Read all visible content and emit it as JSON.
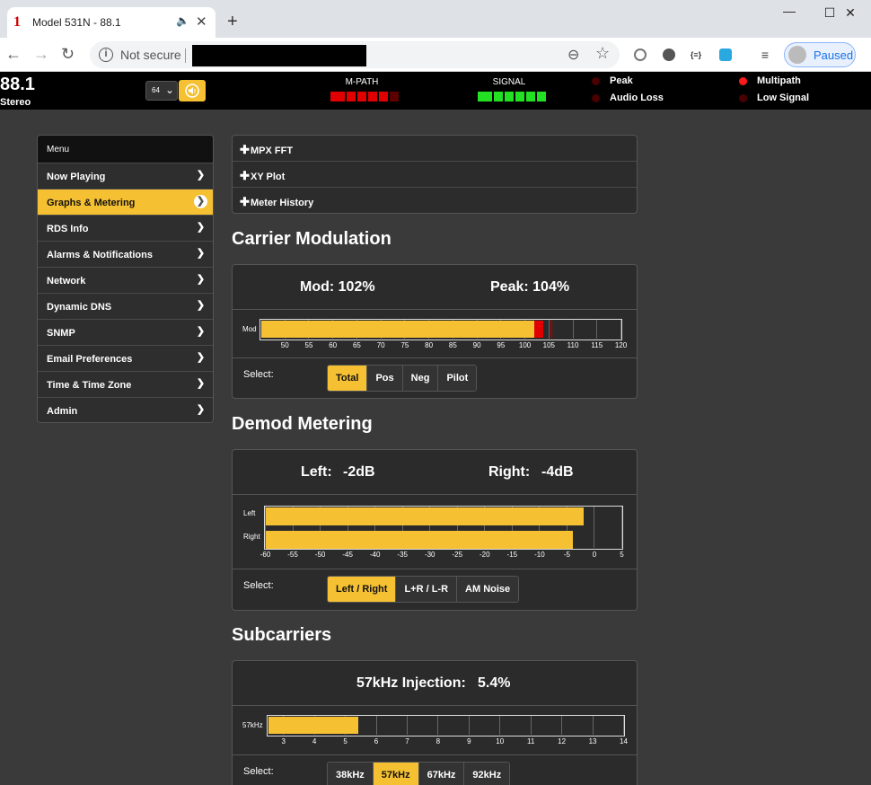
{
  "browser": {
    "tab_title": "Model 531N - 88.1",
    "favicon": "1",
    "new_tab_symbol": "+",
    "minimize_symbol": "—",
    "maximize_symbol": "☐",
    "close_symbol": "✕",
    "not_secure": "Not secure",
    "profile_label": "Paused"
  },
  "status": {
    "frequency": "88.1",
    "mode": "Stereo",
    "volume_value": "64",
    "mpath_label": "M-PATH",
    "signal_label": "SIGNAL",
    "mpath_color": "#e00000",
    "signal_color": "#22e022",
    "indicators": [
      {
        "label": "Peak",
        "state": "off"
      },
      {
        "label": "Audio Loss",
        "state": "off"
      },
      {
        "label": "Multipath",
        "state": "on"
      },
      {
        "label": "Low Signal",
        "state": "off"
      }
    ]
  },
  "menu": {
    "title": "Menu",
    "items": [
      {
        "label": "Now Playing",
        "active": false
      },
      {
        "label": "Graphs & Metering",
        "active": true
      },
      {
        "label": "RDS Info",
        "active": false
      },
      {
        "label": "Alarms & Notifications",
        "active": false
      },
      {
        "label": "Network",
        "active": false
      },
      {
        "label": "Dynamic DNS",
        "active": false
      },
      {
        "label": "SNMP",
        "active": false
      },
      {
        "label": "Email Preferences",
        "active": false
      },
      {
        "label": "Time & Time Zone",
        "active": false
      },
      {
        "label": "Admin",
        "active": false
      }
    ]
  },
  "accordion": [
    {
      "label": "MPX FFT"
    },
    {
      "label": "XY Plot"
    },
    {
      "label": "Meter History"
    }
  ],
  "carrier": {
    "title": "Carrier Modulation",
    "mod_text": "Mod: 102%",
    "peak_text": "Peak: 104%",
    "row_label": "Mod",
    "mod_value": 102,
    "peak_value": 104,
    "scale_min": 45,
    "scale_max": 120,
    "ticks": [
      "50",
      "55",
      "60",
      "65",
      "70",
      "75",
      "80",
      "85",
      "90",
      "95",
      "100",
      "105",
      "110",
      "115",
      "120"
    ],
    "select_label": "Select:",
    "buttons": [
      {
        "label": "Total",
        "on": true
      },
      {
        "label": "Pos",
        "on": false
      },
      {
        "label": "Neg",
        "on": false
      },
      {
        "label": "Pilot",
        "on": false
      }
    ]
  },
  "demod": {
    "title": "Demod Metering",
    "left_label": "Left:",
    "left_value": "-2dB",
    "right_label": "Right:",
    "right_value": "-4dB",
    "rows": [
      {
        "label": "Left",
        "value": -2
      },
      {
        "label": "Right",
        "value": -4
      }
    ],
    "scale_min": -60,
    "scale_max": 5,
    "ticks": [
      "-60",
      "-55",
      "-50",
      "-45",
      "-40",
      "-35",
      "-30",
      "-25",
      "-20",
      "-15",
      "-10",
      "-5",
      "0",
      "5"
    ],
    "select_label": "Select:",
    "buttons": [
      {
        "label": "Left / Right",
        "on": true
      },
      {
        "label": "L+R / L-R",
        "on": false
      },
      {
        "label": "AM Noise",
        "on": false
      }
    ]
  },
  "subcarriers": {
    "title": "Subcarriers",
    "injection_label": "57kHz Injection:",
    "injection_value": "5.4%",
    "row_label": "57kHz",
    "value": 5.4,
    "scale_min": 2.5,
    "scale_max": 14,
    "ticks": [
      "3",
      "4",
      "5",
      "6",
      "7",
      "8",
      "9",
      "10",
      "11",
      "12",
      "13",
      "14"
    ],
    "select_label": "Select:",
    "buttons": [
      {
        "label": "38kHz",
        "on": false
      },
      {
        "label": "57kHz",
        "on": true
      },
      {
        "label": "67kHz",
        "on": false
      },
      {
        "label": "92kHz",
        "on": false
      }
    ]
  }
}
